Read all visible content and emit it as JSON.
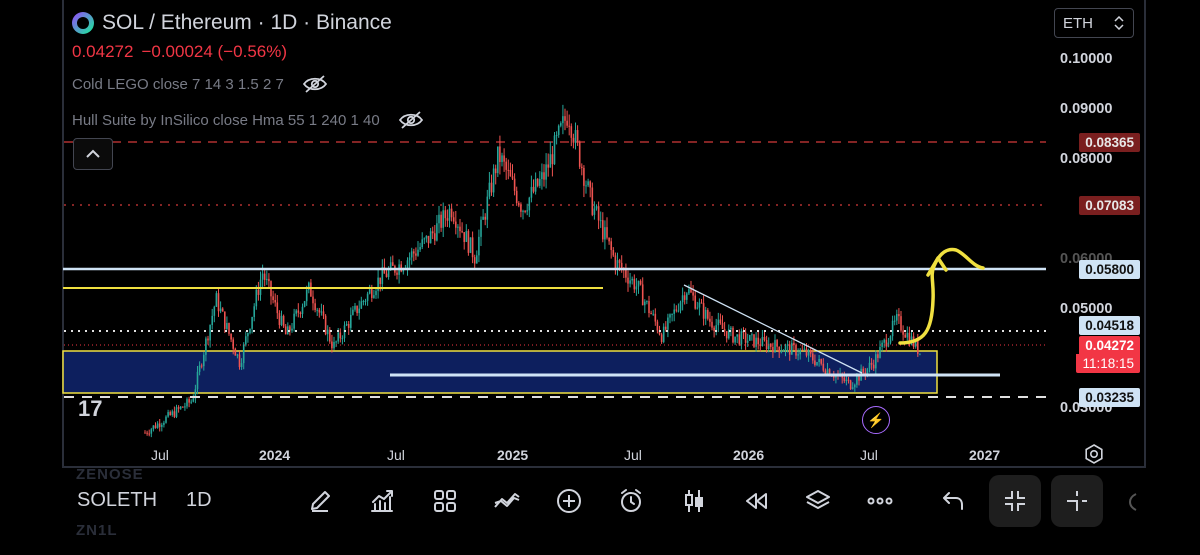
{
  "header": {
    "title": "SOL / Ethereum · 1D · Binance",
    "price": "0.04272",
    "change": "−0.00024 (−0.56%)"
  },
  "indicators": [
    {
      "name": "Cold LEGO close 7 14 3 1.5 2 7"
    },
    {
      "name": "Hull Suite by InSilico close Hma 55 1 240 1 40"
    }
  ],
  "currency": {
    "value": "ETH"
  },
  "price_axis": [
    "0.10000",
    "0.09000",
    "0.08000",
    "0.06000",
    "0.05000",
    "0.03000"
  ],
  "price_tags": {
    "red_dashed": "0.08365",
    "red_dotted": "0.07083",
    "resistance": "0.05800",
    "dotted_white": "0.04518",
    "current": "0.04272",
    "countdown": "11:18:15",
    "support": "0.03235"
  },
  "time_axis": [
    {
      "label": "Jul",
      "major": false
    },
    {
      "label": "2024",
      "major": true
    },
    {
      "label": "Jul",
      "major": false
    },
    {
      "label": "2025",
      "major": true
    },
    {
      "label": "Jul",
      "major": false
    },
    {
      "label": "2026",
      "major": true
    },
    {
      "label": "Jul",
      "major": false
    },
    {
      "label": "2027",
      "major": true
    }
  ],
  "tv_logo": "17",
  "bottom_bar": {
    "ghost_top": "ZENOSE",
    "symbol": "SOLETH",
    "interval": "1D",
    "ghost_bottom": "ZN1L"
  },
  "colors": {
    "up": "#26a69a",
    "down": "#ef5350",
    "accent_red": "#b03030",
    "yellow": "#f0e040",
    "light_blue": "#cfe3f5",
    "box_fill": "#0d1f5e"
  },
  "chart_data": {
    "type": "candlestick",
    "symbol": "SOL / Ethereum",
    "interval": "1D",
    "exchange": "Binance",
    "y_unit": "ETH",
    "ylim": [
      0.027,
      0.107
    ],
    "x_ticks": [
      "Jul",
      "2024",
      "Jul",
      "2025",
      "Jul",
      "2026",
      "Jul",
      "2027"
    ],
    "close_path": [
      [
        "2023-10",
        0.028
      ],
      [
        "2023-12",
        0.034
      ],
      [
        "2024-01",
        0.053
      ],
      [
        "2024-02",
        0.041
      ],
      [
        "2024-03",
        0.058
      ],
      [
        "2024-04",
        0.046
      ],
      [
        "2024-05",
        0.055
      ],
      [
        "2024-06",
        0.044
      ],
      [
        "2024-07",
        0.051
      ],
      [
        "2024-08",
        0.057
      ],
      [
        "2024-09",
        0.06
      ],
      [
        "2024-10",
        0.064
      ],
      [
        "2024-11",
        0.07
      ],
      [
        "2024-12",
        0.061
      ],
      [
        "2025-01",
        0.08
      ],
      [
        "2025-02",
        0.07
      ],
      [
        "2025-03",
        0.076
      ],
      [
        "2025-04",
        0.088
      ],
      [
        "2025-05",
        0.071
      ],
      [
        "2025-06",
        0.06
      ],
      [
        "2025-07",
        0.055
      ],
      [
        "2025-08",
        0.046
      ],
      [
        "2025-09",
        0.055
      ],
      [
        "2025-10",
        0.049
      ],
      [
        "2025-11",
        0.046
      ],
      [
        "2025-12",
        0.045
      ],
      [
        "2026-01",
        0.044
      ],
      [
        "2026-02",
        0.043
      ],
      [
        "2026-03",
        0.04
      ],
      [
        "2026-04",
        0.037
      ],
      [
        "2026-05",
        0.041
      ],
      [
        "2026-06",
        0.049
      ],
      [
        "2026-07",
        0.043
      ]
    ],
    "horizontal_levels": [
      {
        "value": 0.08365,
        "style": "dashed",
        "color": "red"
      },
      {
        "value": 0.07083,
        "style": "dotted",
        "color": "red"
      },
      {
        "value": 0.058,
        "style": "solid",
        "color": "light_blue"
      },
      {
        "value": 0.0556,
        "style": "solid",
        "color": "yellow"
      },
      {
        "value": 0.04518,
        "style": "dotted",
        "color": "white"
      },
      {
        "value": 0.03235,
        "style": "dashed",
        "color": "white"
      }
    ],
    "current_price": 0.04272
  }
}
